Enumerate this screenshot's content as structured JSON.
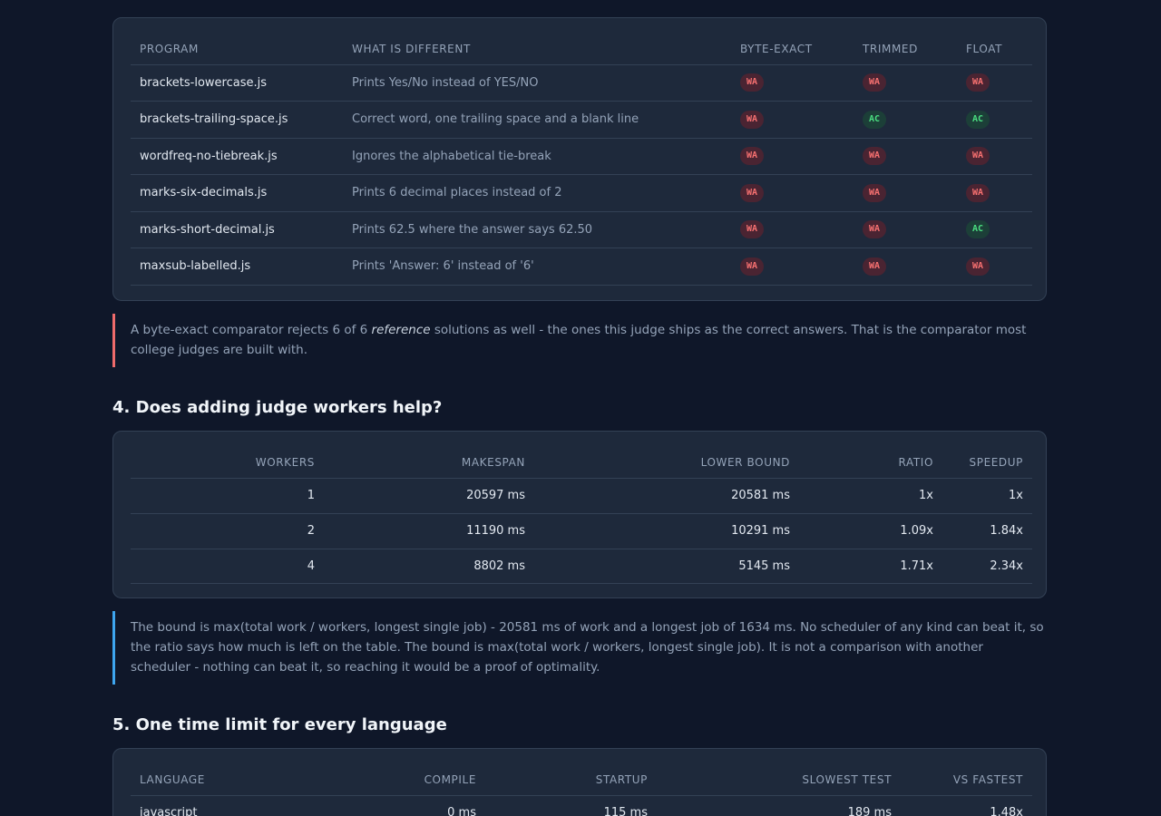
{
  "colors": {
    "background": "#0f1729",
    "card": "#1e293b",
    "wa": "#f87171",
    "ac": "#4ade80",
    "note_red": "#ef6b6b",
    "note_blue": "#3ea6ef"
  },
  "comparator_table": {
    "headers": [
      "PROGRAM",
      "WHAT IS DIFFERENT",
      "BYTE-EXACT",
      "TRIMMED",
      "FLOAT"
    ],
    "rows": [
      {
        "program": "brackets-lowercase.js",
        "diff": "Prints Yes/No instead of YES/NO",
        "byte_exact": "WA",
        "trimmed": "WA",
        "float": "WA"
      },
      {
        "program": "brackets-trailing-space.js",
        "diff": "Correct word, one trailing space and a blank line",
        "byte_exact": "WA",
        "trimmed": "AC",
        "float": "AC"
      },
      {
        "program": "wordfreq-no-tiebreak.js",
        "diff": "Ignores the alphabetical tie-break",
        "byte_exact": "WA",
        "trimmed": "WA",
        "float": "WA"
      },
      {
        "program": "marks-six-decimals.js",
        "diff": "Prints 6 decimal places instead of 2",
        "byte_exact": "WA",
        "trimmed": "WA",
        "float": "WA"
      },
      {
        "program": "marks-short-decimal.js",
        "diff": "Prints 62.5 where the answer says 62.50",
        "byte_exact": "WA",
        "trimmed": "WA",
        "float": "AC"
      },
      {
        "program": "maxsub-labelled.js",
        "diff": "Prints 'Answer: 6' instead of '6'",
        "byte_exact": "WA",
        "trimmed": "WA",
        "float": "WA"
      }
    ]
  },
  "note1": {
    "before": "A byte-exact comparator rejects 6 of 6 ",
    "emphasis": "reference",
    "after": " solutions as well - the ones this judge ships as the correct answers. That is the comparator most college judges are built with."
  },
  "section4": {
    "title": "4. Does adding judge workers help?"
  },
  "workers_table": {
    "headers": [
      "WORKERS",
      "MAKESPAN",
      "LOWER BOUND",
      "RATIO",
      "SPEEDUP"
    ],
    "rows": [
      {
        "workers": "1",
        "makespan": "20597 ms",
        "lower_bound": "20581 ms",
        "ratio": "1x",
        "speedup": "1x"
      },
      {
        "workers": "2",
        "makespan": "11190 ms",
        "lower_bound": "10291 ms",
        "ratio": "1.09x",
        "speedup": "1.84x"
      },
      {
        "workers": "4",
        "makespan": "8802 ms",
        "lower_bound": "5145 ms",
        "ratio": "1.71x",
        "speedup": "2.34x"
      }
    ]
  },
  "note2": {
    "text": "The bound is max(total work / workers, longest single job) - 20581 ms of work and a longest job of 1634 ms. No scheduler of any kind can beat it, so the ratio says how much is left on the table. The bound is max(total work / workers, longest single job). It is not a comparison with another scheduler - nothing can beat it, so reaching it would be a proof of optimality."
  },
  "section5": {
    "title": "5. One time limit for every language"
  },
  "language_table": {
    "headers": [
      "LANGUAGE",
      "COMPILE",
      "STARTUP",
      "SLOWEST TEST",
      "VS FASTEST"
    ],
    "rows": [
      {
        "language": "javascript",
        "compile": "0 ms",
        "startup": "115 ms",
        "slowest": "189 ms",
        "vs_fastest": "1.48x"
      }
    ]
  }
}
